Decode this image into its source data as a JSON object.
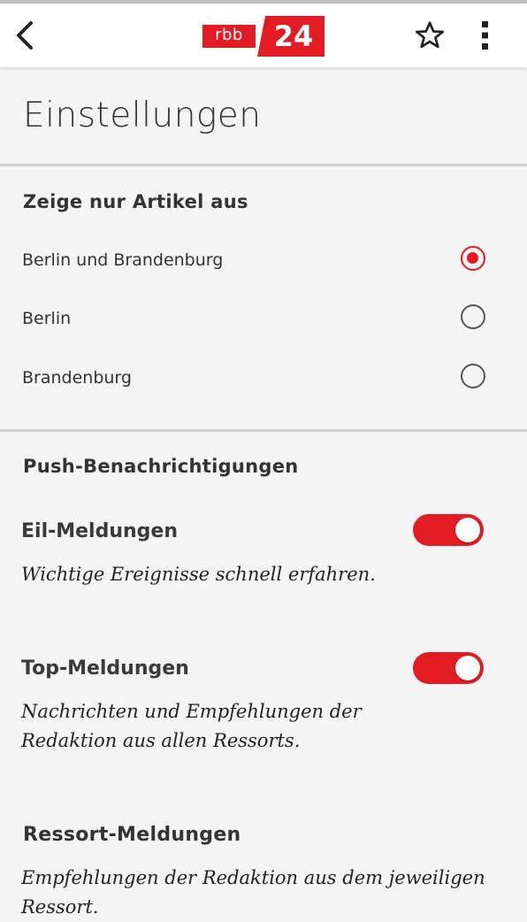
{
  "header": {
    "back_icon": "back-chevron-icon",
    "logo": {
      "part1": "rbb",
      "part2": "24",
      "color": "#e31b23"
    },
    "favorite_icon": "star-outline-icon",
    "menu_icon": "more-vertical-icon"
  },
  "page": {
    "title": "Einstellungen"
  },
  "region": {
    "heading": "Zeige nur Artikel aus",
    "options": [
      {
        "label": "Berlin und Brandenburg",
        "selected": true
      },
      {
        "label": "Berlin",
        "selected": false
      },
      {
        "label": "Brandenburg",
        "selected": false
      }
    ]
  },
  "push": {
    "heading": "Push-Benachrichtigungen",
    "items": [
      {
        "title": "Eil-Meldungen",
        "description": "Wichtige Ereignisse schnell erfahren.",
        "enabled": true
      },
      {
        "title": "Top-Meldungen",
        "description": "Nachrichten und Empfehlungen der Redaktion aus allen Ressorts.",
        "enabled": true
      },
      {
        "title": "Ressort-Meldungen",
        "description": "Empfehlungen der Redaktion aus dem jeweiligen Ressort."
      }
    ]
  },
  "colors": {
    "accent": "#e31b23",
    "background": "#f4f4f4"
  }
}
